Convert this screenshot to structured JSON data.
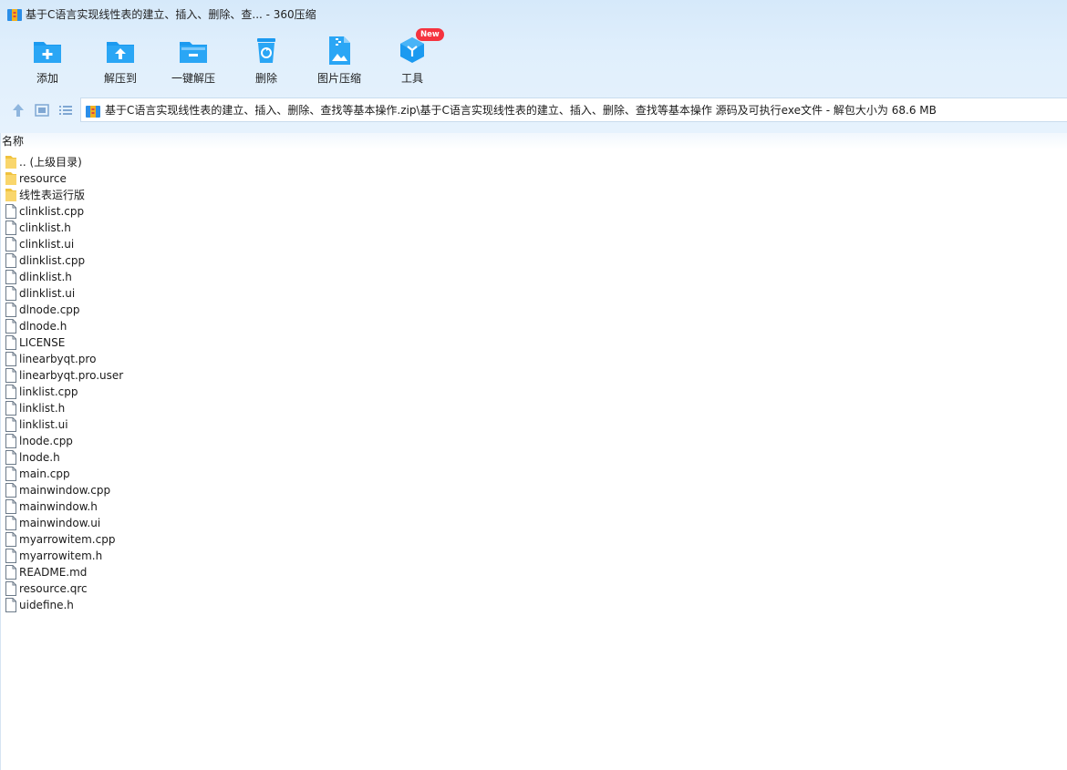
{
  "window": {
    "title": "基于C语言实现线性表的建立、插入、删除、查... - 360压缩"
  },
  "toolbar": [
    {
      "label": "添加",
      "icon": "add-folder-icon"
    },
    {
      "label": "解压到",
      "icon": "extract-to-icon"
    },
    {
      "label": "一键解压",
      "icon": "one-click-extract-icon"
    },
    {
      "label": "删除",
      "icon": "delete-bin-icon"
    },
    {
      "label": "图片压缩",
      "icon": "image-compress-icon"
    },
    {
      "label": "工具",
      "icon": "tools-cube-icon",
      "badge": "New"
    }
  ],
  "address": {
    "path": "基于C语言实现线性表的建立、插入、删除、查找等基本操作.zip\\基于C语言实现线性表的建立、插入、删除、查找等基本操作 源码及可执行exe文件 - 解包大小为 68.6 MB"
  },
  "list": {
    "column": "名称",
    "items": [
      {
        "name": ".. (上级目录)",
        "type": "folder"
      },
      {
        "name": "resource",
        "type": "folder"
      },
      {
        "name": "线性表运行版",
        "type": "folder"
      },
      {
        "name": "clinklist.cpp",
        "type": "file"
      },
      {
        "name": "clinklist.h",
        "type": "file"
      },
      {
        "name": "clinklist.ui",
        "type": "file"
      },
      {
        "name": "dlinklist.cpp",
        "type": "file"
      },
      {
        "name": "dlinklist.h",
        "type": "file"
      },
      {
        "name": "dlinklist.ui",
        "type": "file"
      },
      {
        "name": "dlnode.cpp",
        "type": "file"
      },
      {
        "name": "dlnode.h",
        "type": "file"
      },
      {
        "name": "LICENSE",
        "type": "file"
      },
      {
        "name": "linearbyqt.pro",
        "type": "file"
      },
      {
        "name": "linearbyqt.pro.user",
        "type": "file"
      },
      {
        "name": "linklist.cpp",
        "type": "file"
      },
      {
        "name": "linklist.h",
        "type": "file"
      },
      {
        "name": "linklist.ui",
        "type": "file"
      },
      {
        "name": "lnode.cpp",
        "type": "file"
      },
      {
        "name": "lnode.h",
        "type": "file"
      },
      {
        "name": "main.cpp",
        "type": "file"
      },
      {
        "name": "mainwindow.cpp",
        "type": "file"
      },
      {
        "name": "mainwindow.h",
        "type": "file"
      },
      {
        "name": "mainwindow.ui",
        "type": "file"
      },
      {
        "name": "myarrowitem.cpp",
        "type": "file"
      },
      {
        "name": "myarrowitem.h",
        "type": "file"
      },
      {
        "name": "README.md",
        "type": "file"
      },
      {
        "name": "resource.qrc",
        "type": "file"
      },
      {
        "name": "uidefine.h",
        "type": "file"
      }
    ]
  },
  "colors": {
    "accent": "#1da1f2",
    "folder": "#f9d66c",
    "badge": "#f5333f"
  }
}
